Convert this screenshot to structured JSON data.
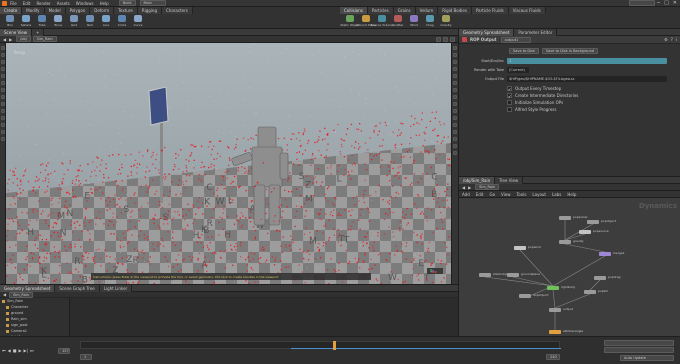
{
  "menubar": {
    "items": [
      "File",
      "Edit",
      "Render",
      "Assets",
      "Windows",
      "Help"
    ],
    "build_label": "Build",
    "desktop_dropdown": "Main"
  },
  "shelf_tabs": [
    "Create",
    "Modify",
    "Model",
    "Polygon",
    "Deform",
    "Texture",
    "Rigging",
    "Characters"
  ],
  "shelf_tools": [
    "Box",
    "Sphere",
    "Tube",
    "Torus",
    "Grid",
    "Null",
    "Line",
    "Circle",
    "Curve"
  ],
  "dyn_shelf_tabs": [
    "Collisions",
    "Particles",
    "Grains",
    "Vellum",
    "Rigid Bodies",
    "Particle Fluids",
    "Viscous Fluids"
  ],
  "dyn_tools": [
    "Static Object",
    "Ground Plane",
    "Source Volume",
    "Scatter",
    "Wind",
    "Drag",
    "Gravity"
  ],
  "viewport": {
    "tab": "Scene View",
    "path": "/obj",
    "node": "Sim_Rain",
    "perspective": "Persp",
    "camera": "No cam",
    "status_text": "Instructions: press Enter in the viewport to activate the tool, or select geometry. Ctrl-click to create handles in the viewport"
  },
  "params": {
    "tabs": [
      "Geometry Spreadsheet",
      "Parameter Editor"
    ],
    "node_type": "ROP Output",
    "node_name": "output1",
    "save_btn": "Save to Disk",
    "save_bg_btn": "Save to Disk in Background",
    "fields": [
      {
        "label": "Start/End/Inc",
        "value": "1"
      },
      {
        "label": "Render with Take",
        "value": "(Current)"
      },
      {
        "label": "Output File",
        "value": "$HIP/geo/$HIPNAME.$OS.$F4.bgeo.sc"
      }
    ],
    "checks": [
      {
        "label": "Output Every Timestep",
        "checked": true
      },
      {
        "label": "Create Intermediate Directories",
        "checked": true
      },
      {
        "label": "Initialize Simulation OPs",
        "checked": false
      },
      {
        "label": "Alfred Style Progress",
        "checked": false
      }
    ]
  },
  "network": {
    "tabs": [
      "/obj/Sim_Rain",
      "Tree View"
    ],
    "path": "Sim_Rain",
    "menu": [
      "Add",
      "Edit",
      "Go",
      "View",
      "Tools",
      "Layout",
      "Labs",
      "Help"
    ],
    "context_label": "Dynamics",
    "nodes": [
      {
        "label": "popsolver"
      },
      {
        "label": "popobject"
      },
      {
        "label": "popsource"
      },
      {
        "label": "gravity"
      },
      {
        "label": "popwind"
      },
      {
        "label": "merge1"
      },
      {
        "label": "staticobject"
      },
      {
        "label": "groundplane"
      },
      {
        "label": "rigidbody"
      },
      {
        "label": "output"
      },
      {
        "label": "dopimport"
      },
      {
        "label": "popdrag"
      },
      {
        "label": "popkill"
      },
      {
        "label": "attribwrangle"
      }
    ]
  },
  "outliner": {
    "tabs": [
      "Geometry Spreadsheet",
      "Scene Graph Tree",
      "Light Linker"
    ],
    "items": [
      "Sim_Rain",
      "Character",
      "ground",
      "Rain_sim",
      "sign_post",
      "Camera1",
      "light1"
    ]
  },
  "timeline": {
    "frame": "127",
    "start": "1",
    "end": "240",
    "auto_update": "Auto Update"
  },
  "colors": {
    "viewport_bg": "#9aa6ac",
    "particles": "#e8161c",
    "accent_teal": "#4a8fa0",
    "panel_bg": "#333333"
  }
}
